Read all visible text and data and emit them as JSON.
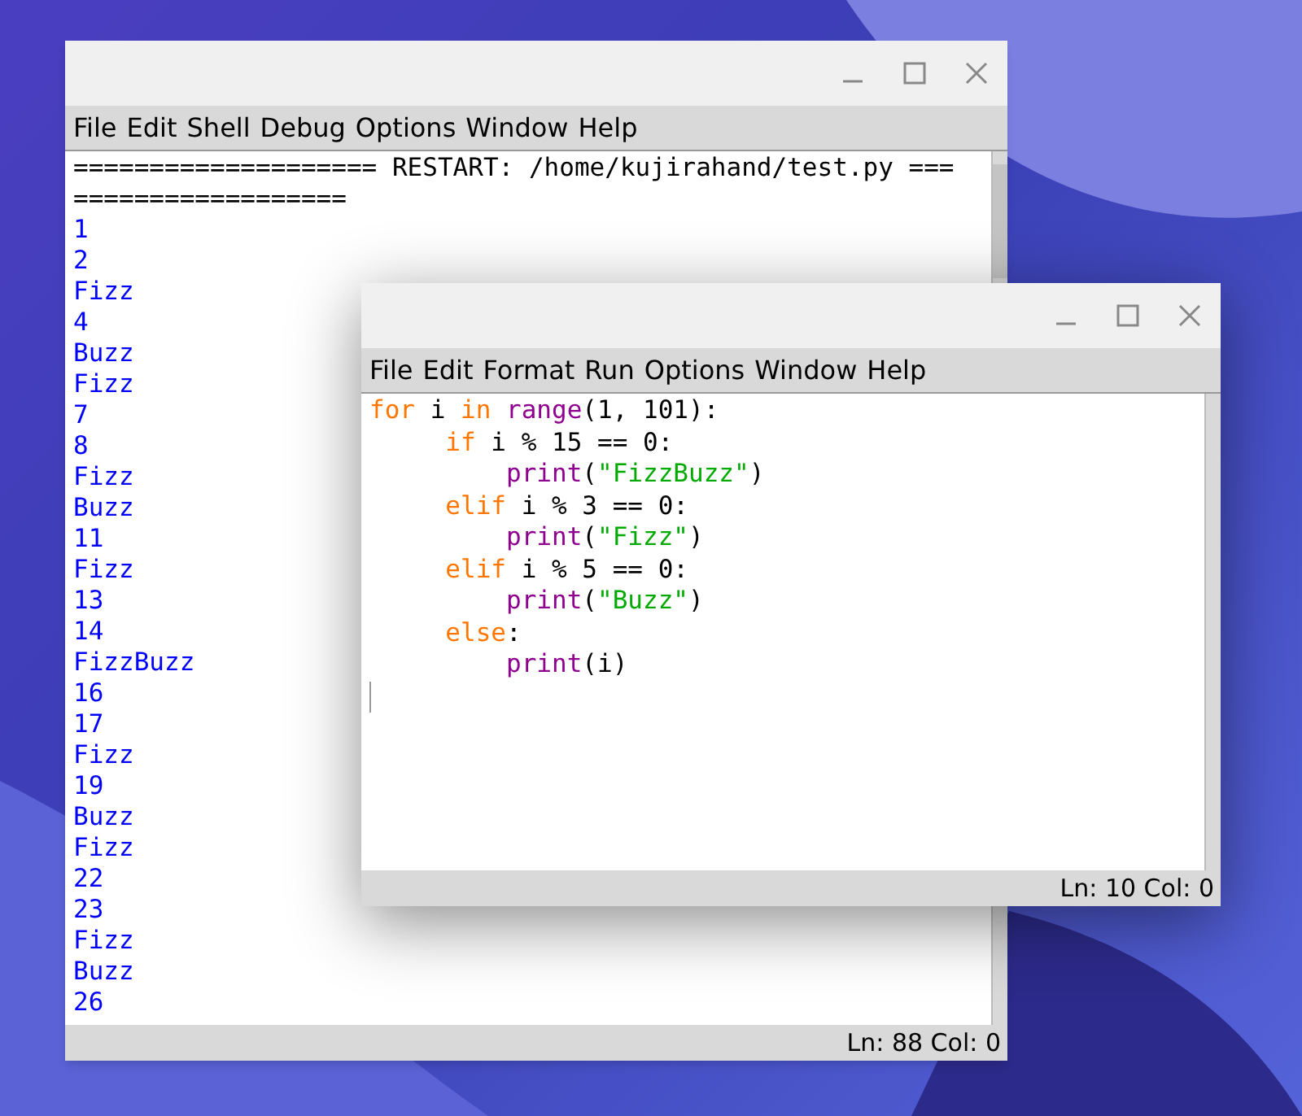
{
  "shell_window": {
    "menu": [
      "File",
      "Edit",
      "Shell",
      "Debug",
      "Options",
      "Window",
      "Help"
    ],
    "output": [
      {
        "kind": "header",
        "text": "==================== RESTART: /home/kujirahand/test.py ==="
      },
      {
        "kind": "header",
        "text": "=================="
      },
      {
        "kind": "result",
        "text": "1"
      },
      {
        "kind": "result",
        "text": "2"
      },
      {
        "kind": "result",
        "text": "Fizz"
      },
      {
        "kind": "result",
        "text": "4"
      },
      {
        "kind": "result",
        "text": "Buzz"
      },
      {
        "kind": "result",
        "text": "Fizz"
      },
      {
        "kind": "result",
        "text": "7"
      },
      {
        "kind": "result",
        "text": "8"
      },
      {
        "kind": "result",
        "text": "Fizz"
      },
      {
        "kind": "result",
        "text": "Buzz"
      },
      {
        "kind": "result",
        "text": "11"
      },
      {
        "kind": "result",
        "text": "Fizz"
      },
      {
        "kind": "result",
        "text": "13"
      },
      {
        "kind": "result",
        "text": "14"
      },
      {
        "kind": "result",
        "text": "FizzBuzz"
      },
      {
        "kind": "result",
        "text": "16"
      },
      {
        "kind": "result",
        "text": "17"
      },
      {
        "kind": "result",
        "text": "Fizz"
      },
      {
        "kind": "result",
        "text": "19"
      },
      {
        "kind": "result",
        "text": "Buzz"
      },
      {
        "kind": "result",
        "text": "Fizz"
      },
      {
        "kind": "result",
        "text": "22"
      },
      {
        "kind": "result",
        "text": "23"
      },
      {
        "kind": "result",
        "text": "Fizz"
      },
      {
        "kind": "result",
        "text": "Buzz"
      },
      {
        "kind": "result",
        "text": "26"
      }
    ],
    "status": "Ln: 88 Col: 0"
  },
  "editor_window": {
    "menu": [
      "File",
      "Edit",
      "Format",
      "Run",
      "Options",
      "Window",
      "Help"
    ],
    "code": [
      [
        {
          "kind": "keyword",
          "text": "for"
        },
        {
          "kind": "plain",
          "text": " i "
        },
        {
          "kind": "keyword",
          "text": "in"
        },
        {
          "kind": "builtin",
          "text": " range"
        },
        {
          "kind": "plain",
          "text": "(1, 101):"
        }
      ],
      [
        {
          "kind": "keyword",
          "text": "     if"
        },
        {
          "kind": "plain",
          "text": " i % 15 == 0:"
        }
      ],
      [
        {
          "kind": "builtin",
          "text": "         print"
        },
        {
          "kind": "plain",
          "text": "("
        },
        {
          "kind": "string",
          "text": "\"FizzBuzz\""
        },
        {
          "kind": "plain",
          "text": ")"
        }
      ],
      [
        {
          "kind": "keyword",
          "text": "     elif"
        },
        {
          "kind": "plain",
          "text": " i % 3 == 0:"
        }
      ],
      [
        {
          "kind": "builtin",
          "text": "         print"
        },
        {
          "kind": "plain",
          "text": "("
        },
        {
          "kind": "string",
          "text": "\"Fizz\""
        },
        {
          "kind": "plain",
          "text": ")"
        }
      ],
      [
        {
          "kind": "keyword",
          "text": "     elif"
        },
        {
          "kind": "plain",
          "text": " i % 5 == 0:"
        }
      ],
      [
        {
          "kind": "builtin",
          "text": "         print"
        },
        {
          "kind": "plain",
          "text": "("
        },
        {
          "kind": "string",
          "text": "\"Buzz\""
        },
        {
          "kind": "plain",
          "text": ")"
        }
      ],
      [
        {
          "kind": "keyword",
          "text": "     else"
        },
        {
          "kind": "plain",
          "text": ":"
        }
      ],
      [
        {
          "kind": "builtin",
          "text": "         print"
        },
        {
          "kind": "plain",
          "text": "(i)"
        }
      ]
    ],
    "status": "Ln: 10 Col: 0"
  }
}
